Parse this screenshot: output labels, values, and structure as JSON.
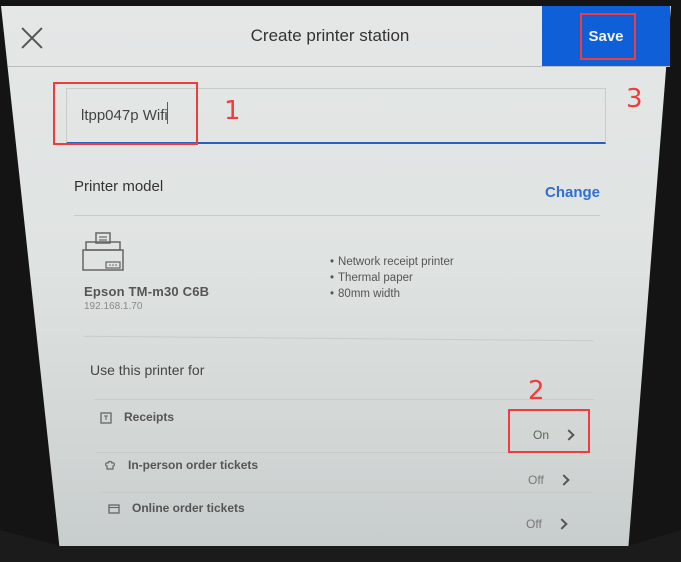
{
  "header": {
    "title": "Create printer station",
    "close_icon": "close-x-icon",
    "save_label": "Save"
  },
  "name_field": {
    "value": "ltpp047p Wifi",
    "placeholder": ""
  },
  "printer_model": {
    "section_label": "Printer model",
    "change_label": "Change",
    "icon": "printer-icon",
    "name": "Epson TM-m30 C6B",
    "ip": "192.168.1.70",
    "features": [
      "Network receipt printer",
      "Thermal paper",
      "80mm width"
    ]
  },
  "use_for": {
    "section_label": "Use this printer for",
    "items": [
      {
        "label": "Receipts",
        "icon": "receipt-icon",
        "status": "On"
      },
      {
        "label": "In-person order tickets",
        "icon": "chef-hat-icon",
        "status": "Off"
      },
      {
        "label": "Online order tickets",
        "icon": "browser-window-icon",
        "status": "Off"
      }
    ]
  },
  "annotations": [
    {
      "number": "1",
      "target": "name field"
    },
    {
      "number": "2",
      "target": "Receipts status"
    },
    {
      "number": "3",
      "target": "Save button"
    }
  ],
  "colors": {
    "accent": "#0e5fd8",
    "link": "#2e6fd0",
    "annotation": "#f03c3c"
  }
}
